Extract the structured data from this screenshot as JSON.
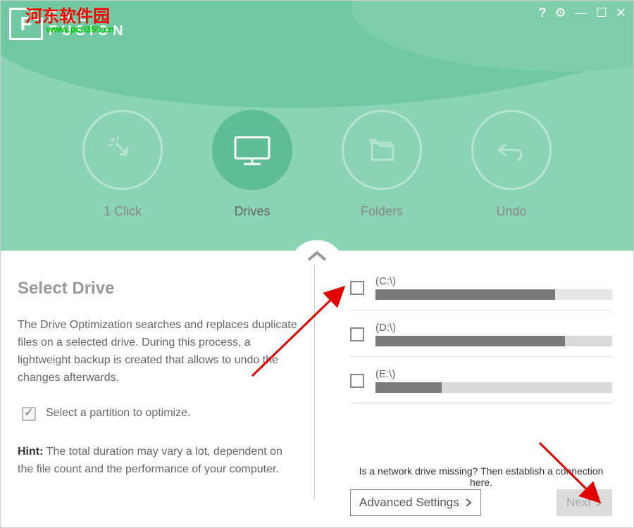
{
  "app": {
    "name_line1": "FILE",
    "name_line2": "FUSION",
    "logo_letter": "F"
  },
  "watermark": {
    "text_cn": "河东软件园",
    "url": "www.pc0359.cn"
  },
  "window_controls": {
    "help": "?",
    "settings": "⚙",
    "minimize": "—",
    "maximize": "☐",
    "close": "✕"
  },
  "modes": {
    "items": [
      {
        "id": "oneclick",
        "label": "1 Click"
      },
      {
        "id": "drives",
        "label": "Drives"
      },
      {
        "id": "folders",
        "label": "Folders"
      },
      {
        "id": "undo",
        "label": "Undo"
      }
    ],
    "active_index": 1
  },
  "left": {
    "title": "Select Drive",
    "description": "The Drive Optimization searches and replaces duplicate files on a selected drive. During this process, a lightweight backup is created that allows to undo the changes afterwards.",
    "partition_instruction": "Select a partition to optimize.",
    "hint_label": "Hint:",
    "hint_text": " The total duration may vary a lot, dependent on the file count and the performance of your computer."
  },
  "drives": [
    {
      "label": "(C:\\)",
      "fill_pct": 76,
      "checked": false
    },
    {
      "label": "(D:\\)",
      "fill_pct": 80,
      "checked": false
    },
    {
      "label": "(E:\\)",
      "fill_pct": 28,
      "checked": false
    }
  ],
  "right": {
    "network_hint": "Is a network drive missing? Then establish a connection here.",
    "advanced_label": "Advanced Settings",
    "next_label": "Next"
  }
}
